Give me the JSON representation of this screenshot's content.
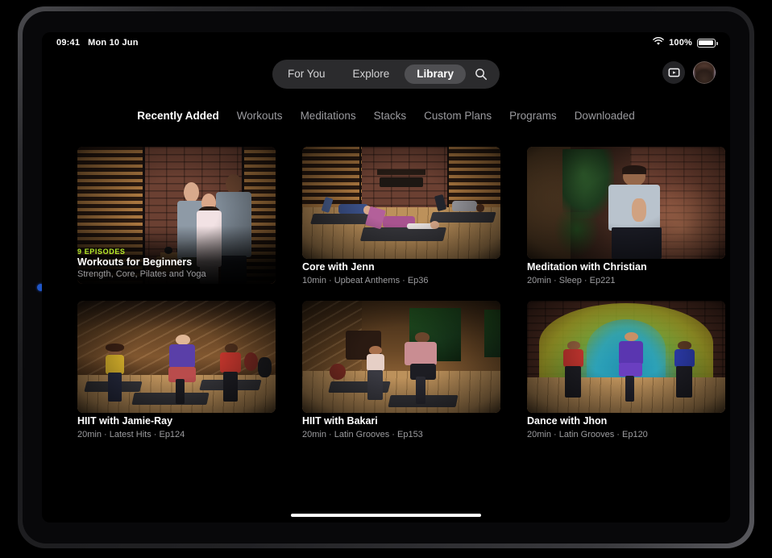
{
  "status_bar": {
    "time": "09:41",
    "date": "Mon 10 Jun",
    "wifi_icon": "wifi-icon",
    "battery_percent": "100%",
    "battery_icon": "battery-icon"
  },
  "top_nav": {
    "segments": [
      {
        "label": "For You",
        "active": false
      },
      {
        "label": "Explore",
        "active": false
      },
      {
        "label": "Library",
        "active": true
      }
    ],
    "search_icon": "search-icon",
    "airplay_icon": "airplay-video-icon",
    "avatar": "profile-avatar"
  },
  "tabs": [
    {
      "label": "Recently Added",
      "active": true
    },
    {
      "label": "Workouts",
      "active": false
    },
    {
      "label": "Meditations",
      "active": false
    },
    {
      "label": "Stacks",
      "active": false
    },
    {
      "label": "Custom Plans",
      "active": false
    },
    {
      "label": "Programs",
      "active": false
    },
    {
      "label": "Downloaded",
      "active": false
    }
  ],
  "cards": [
    {
      "badge": "9 EPISODES",
      "title": "Workouts for Beginners",
      "subtitle": "Strength, Core, Pilates and Yoga",
      "thumbnail": "three-trainers-brick-gym"
    },
    {
      "badge": "",
      "title": "Core with Jenn",
      "subtitle": "10min · Upbeat Anthems · Ep36",
      "thumbnail": "three-people-glute-bridge-mats"
    },
    {
      "badge": "",
      "title": "Meditation with Christian",
      "subtitle": "20min · Sleep · Ep221",
      "thumbnail": "seated-meditation-greenery"
    },
    {
      "badge": "",
      "title": "HIIT with Jamie-Ray",
      "subtitle": "20min · Latest Hits · Ep124",
      "thumbnail": "three-people-high-knees-wood-wall"
    },
    {
      "badge": "",
      "title": "HIIT with Bakari",
      "subtitle": "20min · Latin Grooves · Ep153",
      "thumbnail": "two-people-hiit-window-greenery"
    },
    {
      "badge": "",
      "title": "Dance with Jhon",
      "subtitle": "20min · Latin Grooves · Ep120",
      "thumbnail": "three-dancers-colorful-arch"
    }
  ],
  "colors": {
    "badge_green": "#b6ec2a",
    "active_pill": "#4f4f52",
    "segmented_bg": "#2b2b2d",
    "screen_bg": "#000000",
    "subtitle_grey": "#9c9c9f"
  }
}
